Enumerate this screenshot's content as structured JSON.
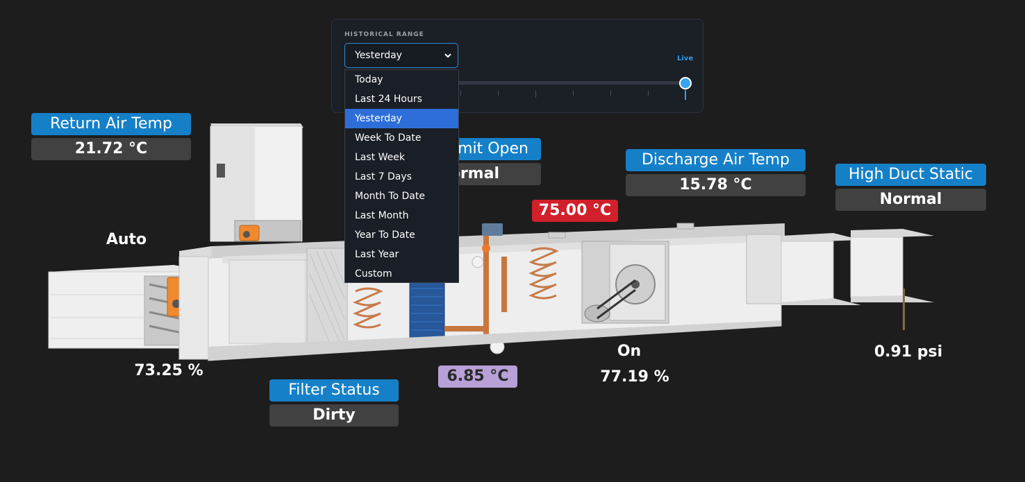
{
  "range": {
    "title": "HISTORICAL RANGE",
    "selected": "Yesterday",
    "live_label": "Live",
    "options": [
      "Today",
      "Last 24 Hours",
      "Yesterday",
      "Week To Date",
      "Last Week",
      "Last 7 Days",
      "Month To Date",
      "Last Month",
      "Year To Date",
      "Last Year",
      "Custom"
    ]
  },
  "return_air": {
    "label": "Return Air Temp",
    "value": "21.72 °C"
  },
  "damper": {
    "mode": "Auto",
    "position": "73.25 %"
  },
  "filter": {
    "label": "Filter Status",
    "value": "Dirty"
  },
  "limit": {
    "label_partial": "mit Open",
    "value_partial": "ormal"
  },
  "heating_temp": "75.00 °C",
  "cooling_temp": "6.85 °C",
  "discharge_air": {
    "label": "Discharge Air Temp",
    "value": "15.78 °C"
  },
  "fan": {
    "status": "On",
    "speed": "77.19 %"
  },
  "duct_static": {
    "label": "High Duct Static",
    "value": "Normal",
    "pressure": "0.91 psi"
  },
  "colors": {
    "label_blue": "#1580c8",
    "value_gray": "#414141",
    "alarm_red": "#d1202a",
    "cool_lavender": "#b8a0d8",
    "select_blue": "#2e6ed8"
  }
}
